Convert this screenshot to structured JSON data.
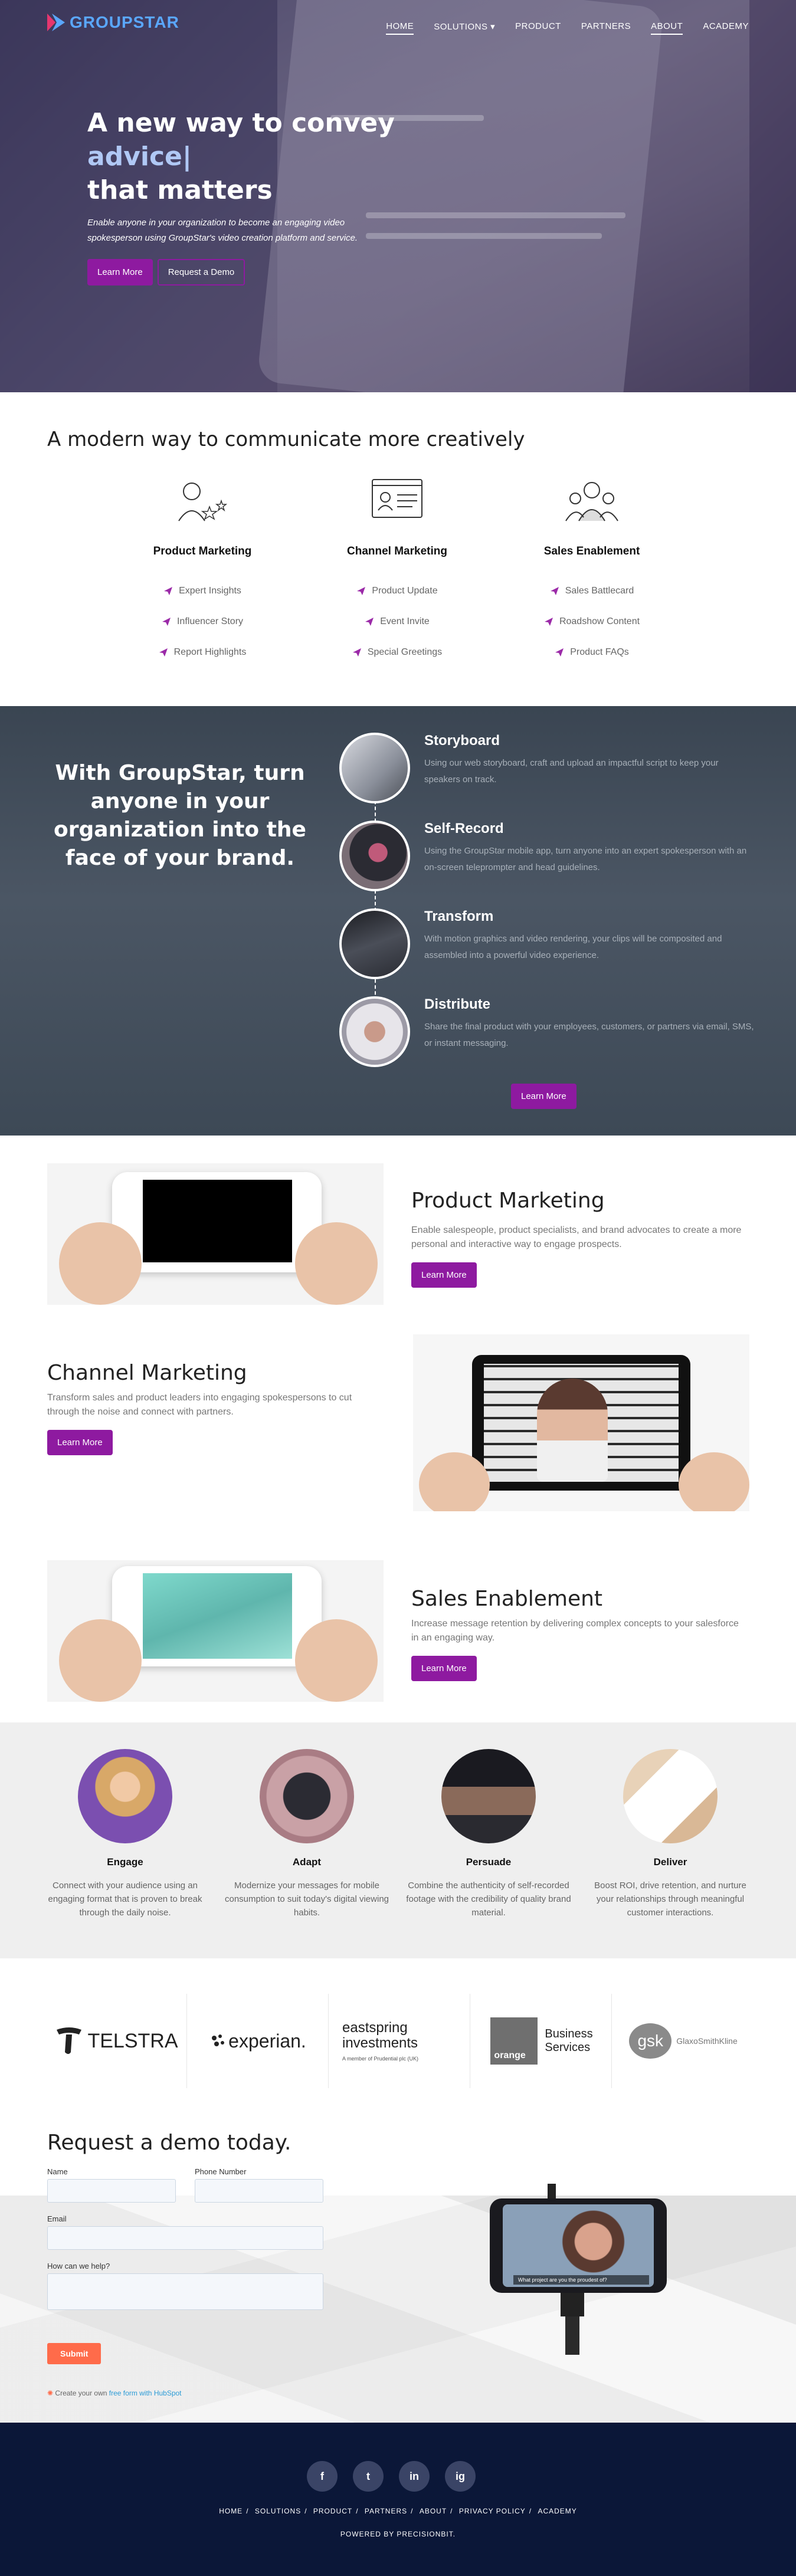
{
  "brand": {
    "name": "GROUPSTAR",
    "accent": "#8e1aa0",
    "logo_color": "#5aa7ff"
  },
  "nav": {
    "items": [
      {
        "label": "HOME",
        "active": true
      },
      {
        "label": "SOLUTIONS ▾",
        "active": false
      },
      {
        "label": "PRODUCT",
        "active": false
      },
      {
        "label": "PARTNERS",
        "active": false
      },
      {
        "label": "ABOUT",
        "active": true
      },
      {
        "label": "ACADEMY",
        "active": false
      }
    ]
  },
  "hero": {
    "line1": "A new way to convey",
    "line2": "advice|",
    "line3": "that matters",
    "subtitle": "Enable anyone in your organization to become an engaging video spokesperson using GroupStar's video creation platform and service.",
    "learn_more": "Learn More",
    "request_demo": "Request a Demo"
  },
  "modern": {
    "title": "A modern way to communicate more creatively",
    "columns": [
      {
        "title": "Product Marketing",
        "items": [
          "Expert Insights",
          "Influencer Story",
          "Report Highlights"
        ]
      },
      {
        "title": "Channel Marketing",
        "items": [
          "Product Update",
          "Event Invite",
          "Special Greetings"
        ]
      },
      {
        "title": "Sales Enablement",
        "items": [
          "Sales Battlecard",
          "Roadshow Content",
          "Product FAQs"
        ]
      }
    ]
  },
  "process": {
    "title": "With GroupStar, turn anyone in your organization into the face of your brand.",
    "steps": [
      {
        "title": "Storyboard",
        "text": "Using our web storyboard, craft and upload an impactful script to keep your speakers on track."
      },
      {
        "title": "Self-Record",
        "text": "Using the GroupStar mobile app, turn anyone into an expert spokesperson with an on-screen teleprompter and head guidelines."
      },
      {
        "title": "Transform",
        "text": "With motion graphics and video rendering, your clips will be composited and assembled into a powerful video experience."
      },
      {
        "title": "Distribute",
        "text": "Share the final product with your employees, customers, or partners via email, SMS, or instant messaging."
      }
    ],
    "button": "Learn More"
  },
  "features": [
    {
      "title": "Product Marketing",
      "text": "Enable salespeople, product specialists, and brand advocates to create a more personal and interactive way to engage prospects.",
      "button": "Learn More"
    },
    {
      "title": "Channel Marketing",
      "text": "Transform sales and product leaders into engaging spokespersons to cut through the noise and connect with partners.",
      "button": "Learn More"
    },
    {
      "title": "Sales Enablement",
      "text": "Increase message retention by delivering complex concepts to your salesforce in an engaging way.",
      "button": "Learn More"
    }
  ],
  "benefits": [
    {
      "title": "Engage",
      "text": "Connect with your audience using an engaging format that is proven to break through the daily noise."
    },
    {
      "title": "Adapt",
      "text": "Modernize your messages for mobile consumption to suit today's digital viewing habits."
    },
    {
      "title": "Persuade",
      "text": "Combine the authenticity of self-recorded footage with the credibility of quality brand material."
    },
    {
      "title": "Deliver",
      "text": "Boost ROI, drive retention, and nurture your relationships through meaningful customer interactions."
    }
  ],
  "clients": {
    "telstra": "TELSTRA",
    "experian": "experian.",
    "eastspring1": "eastspring",
    "eastspring2": "investments",
    "eastspring_tag": "A member of Prudential plc (UK)",
    "orange_word": "orange",
    "orange_bs1": "Business",
    "orange_bs2": "Services",
    "gsk": "gsk",
    "gsk_word": "GlaxoSmithKline"
  },
  "demo": {
    "title": "Request a demo today.",
    "name_label": "Name",
    "phone_label": "Phone Number",
    "email_label": "Email",
    "help_label": "How can we help?",
    "submit": "Submit",
    "hubspot_prefix": "Create your own ",
    "hubspot_link": "free form with HubSpot",
    "phone_caption": "What project are you the proudest of?"
  },
  "footer": {
    "social": [
      "f",
      "t",
      "in",
      "ig"
    ],
    "links": [
      "HOME",
      "SOLUTIONS",
      "PRODUCT",
      "PARTNERS",
      "ABOUT",
      "PRIVACY POLICY",
      "ACADEMY"
    ],
    "powered": "POWERED BY PRECISIONBIT."
  }
}
